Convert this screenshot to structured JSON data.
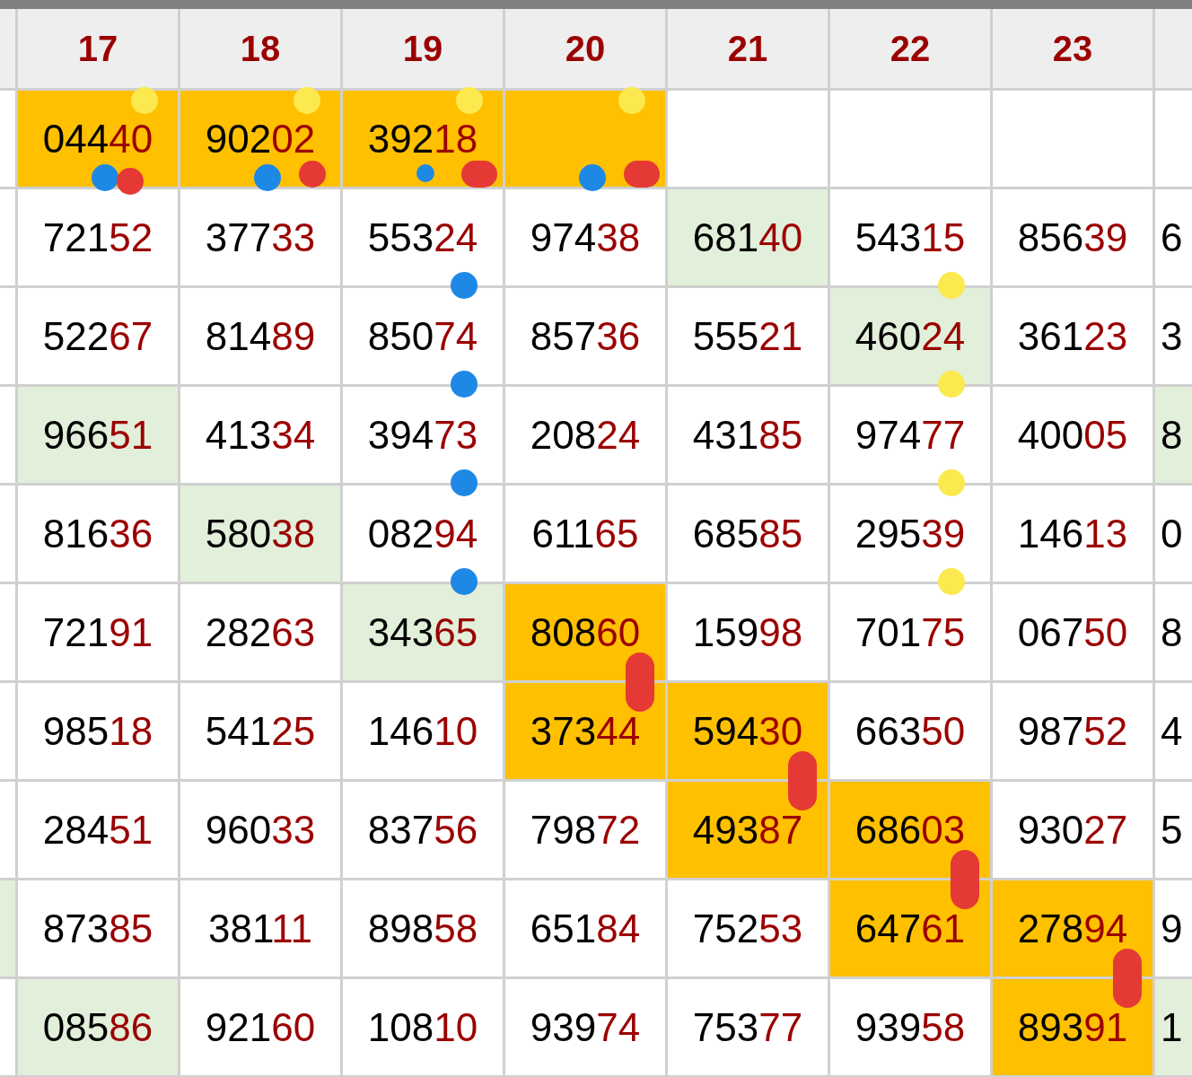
{
  "columns": [
    "17",
    "18",
    "19",
    "20",
    "21",
    "22",
    "23"
  ],
  "rows": [
    {
      "cells": [
        {
          "lead": "044",
          "tail": "40",
          "color": "#ffc000",
          "marks": [
            {
              "kind": "top-dot",
              "color": "#fbe94f"
            },
            {
              "kind": "bottom-dot",
              "color": "#1e88e5"
            },
            {
              "kind": "bottom-right-dot",
              "color": "#e53935"
            }
          ]
        },
        {
          "lead": "902",
          "tail": "02",
          "color": "#ffc000",
          "marks": [
            {
              "kind": "top-dot",
              "color": "#fbe94f"
            },
            {
              "kind": "bottom-dot",
              "color": "#1e88e5"
            },
            {
              "kind": "far-right-dot",
              "color": "#e53935"
            }
          ]
        },
        {
          "lead": "392",
          "tail": "18",
          "color": "#ffc000",
          "marks": [
            {
              "kind": "top-dot",
              "color": "#fbe94f"
            },
            {
              "kind": "small-dot",
              "color": "#1e88e5"
            },
            {
              "kind": "blob",
              "color": "#e53935"
            }
          ]
        },
        {
          "color": "#ffc000",
          "marks": [
            {
              "kind": "top-dot",
              "color": "#fbe94f"
            },
            {
              "kind": "bottom-dot",
              "color": "#1e88e5"
            },
            {
              "kind": "blob",
              "color": "#e53935"
            }
          ]
        },
        {},
        {},
        {}
      ],
      "right_edge": {}
    },
    {
      "cells": [
        {
          "lead": "721",
          "tail": "52"
        },
        {
          "lead": "377",
          "tail": "33"
        },
        {
          "lead": "553",
          "tail": "24",
          "marks": [
            {
              "kind": "edge-dot",
              "color": "#1e88e5"
            }
          ]
        },
        {
          "lead": "974",
          "tail": "38"
        },
        {
          "lead": "681",
          "tail": "40",
          "color": "#e2efda"
        },
        {
          "lead": "543",
          "tail": "15",
          "marks": [
            {
              "kind": "edge-dot",
              "color": "#fbe94f"
            }
          ]
        },
        {
          "lead": "856",
          "tail": "39"
        }
      ],
      "right_edge": {
        "text": "6"
      }
    },
    {
      "cells": [
        {
          "lead": "522",
          "tail": "67"
        },
        {
          "lead": "814",
          "tail": "89"
        },
        {
          "lead": "850",
          "tail": "74",
          "marks": [
            {
              "kind": "edge-dot",
              "color": "#1e88e5"
            }
          ]
        },
        {
          "lead": "857",
          "tail": "36"
        },
        {
          "lead": "555",
          "tail": "21"
        },
        {
          "lead": "460",
          "tail": "24",
          "color": "#e2efda",
          "marks": [
            {
              "kind": "edge-dot",
              "color": "#fbe94f"
            }
          ]
        },
        {
          "lead": "361",
          "tail": "23"
        }
      ],
      "right_edge": {
        "text": "3"
      }
    },
    {
      "cells": [
        {
          "lead": "966",
          "tail": "51",
          "color": "#e2efda"
        },
        {
          "lead": "413",
          "tail": "34"
        },
        {
          "lead": "394",
          "tail": "73",
          "marks": [
            {
              "kind": "edge-dot",
              "color": "#1e88e5"
            }
          ]
        },
        {
          "lead": "208",
          "tail": "24"
        },
        {
          "lead": "431",
          "tail": "85"
        },
        {
          "lead": "974",
          "tail": "77",
          "marks": [
            {
              "kind": "edge-dot",
              "color": "#fbe94f"
            }
          ]
        },
        {
          "lead": "400",
          "tail": "05"
        }
      ],
      "right_edge": {
        "text": "8",
        "color": "#e2efda"
      }
    },
    {
      "cells": [
        {
          "lead": "816",
          "tail": "36"
        },
        {
          "lead": "580",
          "tail": "38",
          "color": "#e2efda"
        },
        {
          "lead": "082",
          "tail": "94",
          "marks": [
            {
              "kind": "edge-dot",
              "color": "#1e88e5"
            }
          ]
        },
        {
          "lead": "611",
          "tail": "65"
        },
        {
          "lead": "685",
          "tail": "85"
        },
        {
          "lead": "295",
          "tail": "39",
          "marks": [
            {
              "kind": "edge-dot",
              "color": "#fbe94f"
            }
          ]
        },
        {
          "lead": "146",
          "tail": "13"
        }
      ],
      "right_edge": {
        "text": "0"
      }
    },
    {
      "cells": [
        {
          "lead": "721",
          "tail": "91"
        },
        {
          "lead": "282",
          "tail": "63"
        },
        {
          "lead": "343",
          "tail": "65",
          "color": "#e2efda"
        },
        {
          "lead": "808",
          "tail": "60",
          "color": "#ffc000",
          "marks": [
            {
              "kind": "stroke",
              "color": "#e53935"
            }
          ]
        },
        {
          "lead": "159",
          "tail": "98"
        },
        {
          "lead": "701",
          "tail": "75"
        },
        {
          "lead": "067",
          "tail": "50"
        }
      ],
      "right_edge": {
        "text": "8"
      }
    },
    {
      "cells": [
        {
          "lead": "985",
          "tail": "18"
        },
        {
          "lead": "541",
          "tail": "25"
        },
        {
          "lead": "146",
          "tail": "10"
        },
        {
          "lead": "373",
          "tail": "44",
          "color": "#ffc000"
        },
        {
          "lead": "594",
          "tail": "30",
          "color": "#ffc000",
          "marks": [
            {
              "kind": "stroke",
              "color": "#e53935"
            }
          ]
        },
        {
          "lead": "663",
          "tail": "50"
        },
        {
          "lead": "987",
          "tail": "52"
        }
      ],
      "right_edge": {
        "text": "4"
      }
    },
    {
      "cells": [
        {
          "lead": "284",
          "tail": "51"
        },
        {
          "lead": "960",
          "tail": "33"
        },
        {
          "lead": "837",
          "tail": "56"
        },
        {
          "lead": "798",
          "tail": "72"
        },
        {
          "lead": "493",
          "tail": "87",
          "color": "#ffc000"
        },
        {
          "lead": "686",
          "tail": "03",
          "color": "#ffc000",
          "marks": [
            {
              "kind": "stroke",
              "color": "#e53935"
            }
          ]
        },
        {
          "lead": "930",
          "tail": "27"
        }
      ],
      "right_edge": {
        "text": "5"
      }
    },
    {
      "left_edge": {
        "color": "#e2efda"
      },
      "cells": [
        {
          "lead": "873",
          "tail": "85"
        },
        {
          "lead": "381",
          "tail": "11"
        },
        {
          "lead": "898",
          "tail": "58"
        },
        {
          "lead": "651",
          "tail": "84"
        },
        {
          "lead": "752",
          "tail": "53"
        },
        {
          "lead": "647",
          "tail": "61",
          "color": "#ffc000"
        },
        {
          "lead": "278",
          "tail": "94",
          "color": "#ffc000",
          "marks": [
            {
              "kind": "stroke",
              "color": "#e53935"
            }
          ]
        }
      ],
      "right_edge": {
        "text": "9"
      }
    },
    {
      "cells": [
        {
          "lead": "085",
          "tail": "86",
          "color": "#e2efda"
        },
        {
          "lead": "921",
          "tail": "60"
        },
        {
          "lead": "108",
          "tail": "10"
        },
        {
          "lead": "939",
          "tail": "74"
        },
        {
          "lead": "753",
          "tail": "77"
        },
        {
          "lead": "939",
          "tail": "58"
        },
        {
          "lead": "893",
          "tail": "91",
          "color": "#ffc000"
        }
      ],
      "right_edge": {
        "text": "1",
        "color": "#e2efda"
      }
    }
  ]
}
